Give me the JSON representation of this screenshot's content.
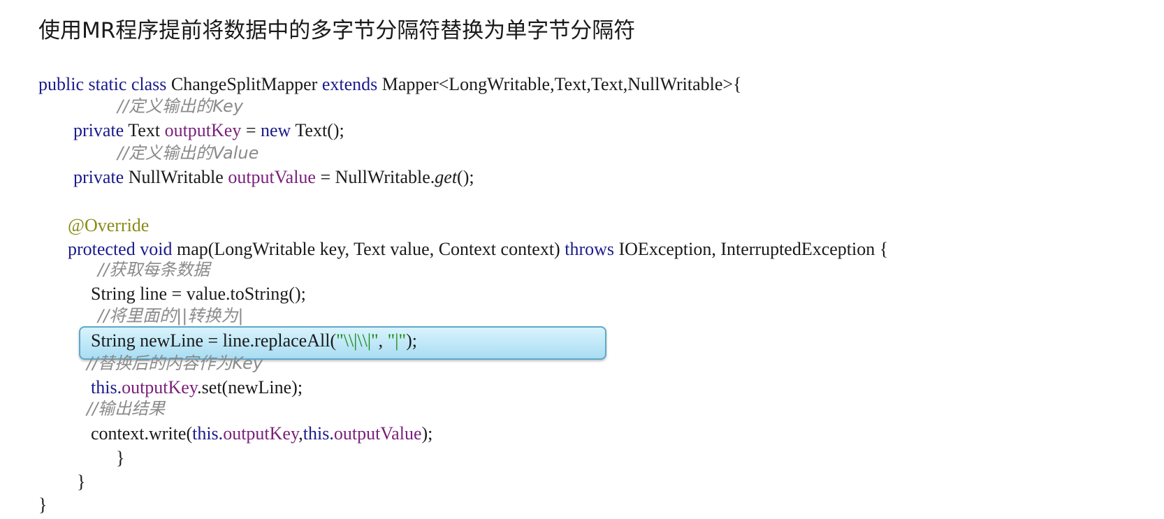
{
  "title": "使用MR程序提前将数据中的多字节分隔符替换为单字节分隔符",
  "code": {
    "l1": {
      "kw_public": "public",
      "kw_static": "static",
      "kw_class": "class",
      "class_name": "ChangeSplitMapper",
      "kw_extends": "extends",
      "generic": "Mapper<LongWritable,Text,Text,NullWritable>{"
    },
    "c1": "//定义输出的Key",
    "l2": {
      "kw_private": "private",
      "type": "Text",
      "field": "outputKey",
      "eq": "=",
      "kw_new": "new",
      "rest": "Text();"
    },
    "c2": "//定义输出的Value",
    "l3": {
      "kw_private": "private",
      "type": "NullWritable",
      "field": "outputValue",
      "eq": "= NullWritable.",
      "method": "get",
      "rest": "();"
    },
    "l4": {
      "annotation": "@Override"
    },
    "l5": {
      "kw_protected": "protected",
      "kw_void": "void",
      "sig": "map(LongWritable key, Text value, Context context)",
      "kw_throws": "throws",
      "rest": "IOException, InterruptedException {"
    },
    "c3": "//获取每条数据",
    "l6": "String line = value.toString();",
    "c4": "//将里面的||转换为|",
    "l7": {
      "pre": "String newLine = line.replaceAll(",
      "str1": "\"\\\\|\\\\|\"",
      "comma": ", ",
      "str2": "\"|\"",
      "end": ");"
    },
    "c5": "//替换后的内容作为Key",
    "l8": {
      "kw_this": "this.",
      "field": "outputKey",
      "rest": ".set(newLine);"
    },
    "c6": "//输出结果",
    "l9": {
      "pre": "context.write(",
      "kw_this1": "this.",
      "field1": "outputKey",
      "comma": ",",
      "kw_this2": "this.",
      "field2": "outputValue",
      "end": ");"
    },
    "b1": "}",
    "b2": "}",
    "b3": "}"
  }
}
